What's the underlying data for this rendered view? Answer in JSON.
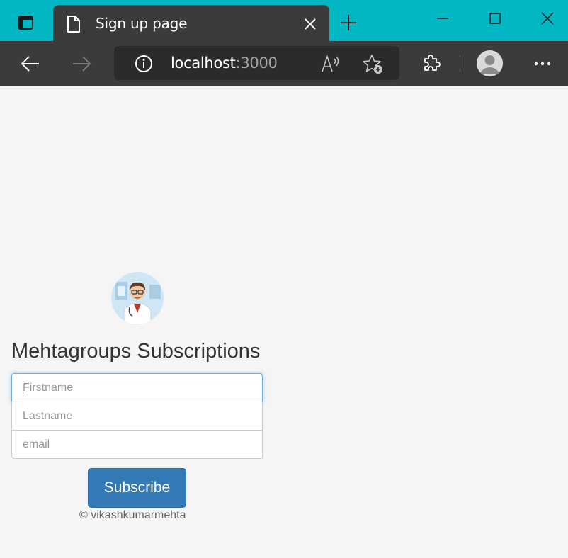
{
  "browser": {
    "tab": {
      "title": "Sign up page"
    },
    "address": {
      "host": "localhost",
      "port": ":3000"
    },
    "accent_color": "#00b7c3",
    "icons": [
      "tab-actions-icon",
      "page-icon",
      "close-icon",
      "plus-icon",
      "minimize-icon",
      "maximize-icon",
      "window-close-icon",
      "back-arrow-icon",
      "forward-arrow-icon",
      "info-icon",
      "read-aloud-icon",
      "add-favorite-icon",
      "extensions-icon",
      "profile-avatar",
      "more-icon"
    ]
  },
  "page": {
    "logo": "doctor-avatar",
    "heading": "Mehtagroups Subscriptions",
    "form": {
      "firstname_placeholder": "Firstname",
      "lastname_placeholder": "Lastname",
      "email_placeholder": "email",
      "submit_label": "Subscribe"
    },
    "footer": "© vikashkumarmehta",
    "button_color": "#337ab7"
  }
}
